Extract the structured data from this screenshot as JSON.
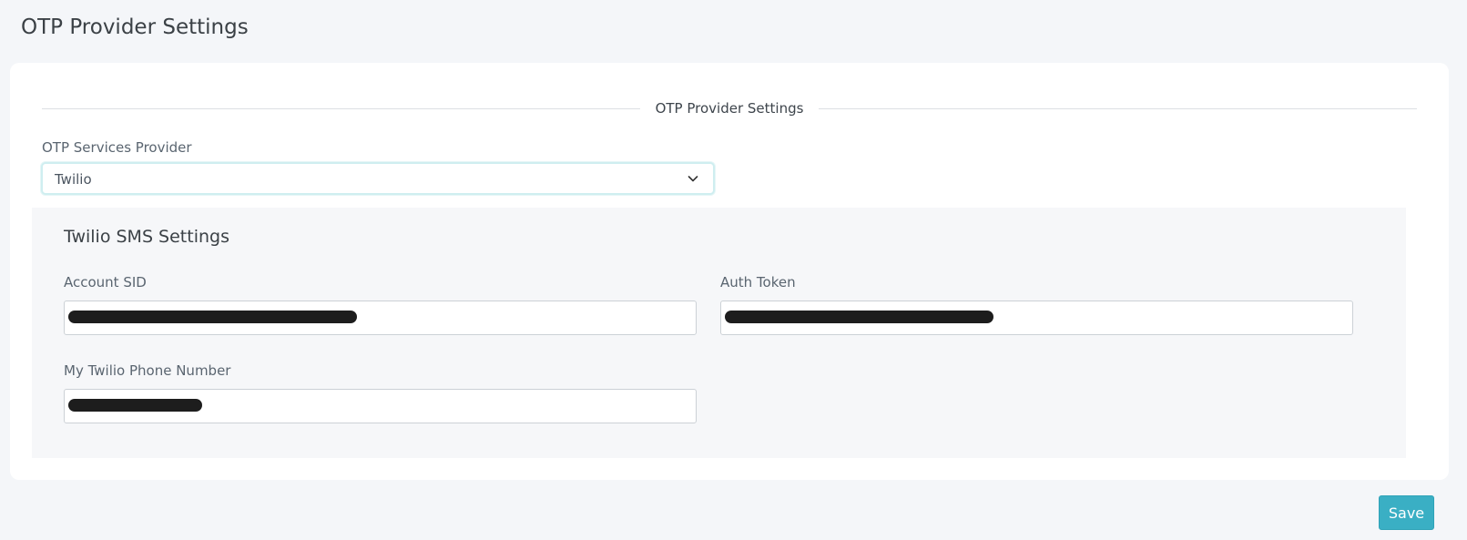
{
  "page": {
    "title": "OTP Provider Settings"
  },
  "section": {
    "divider_label": "OTP Provider Settings"
  },
  "provider": {
    "label": "OTP Services Provider",
    "selected": "Twilio",
    "chevron_icon": "chevron-down-icon"
  },
  "twilio": {
    "title": "Twilio SMS Settings",
    "account_sid": {
      "label": "Account SID",
      "value_redacted": true
    },
    "auth_token": {
      "label": "Auth Token",
      "value_redacted": true
    },
    "phone_number": {
      "label": "My Twilio Phone Number",
      "value_redacted": true
    }
  },
  "actions": {
    "save_label": "Save"
  },
  "colors": {
    "background": "#f4f6f9",
    "card": "#ffffff",
    "subpanel": "#f6f7f9",
    "accent": "#3aafc4",
    "select_focus_border": "#cfeef0",
    "redaction": "#1d1d1d"
  }
}
